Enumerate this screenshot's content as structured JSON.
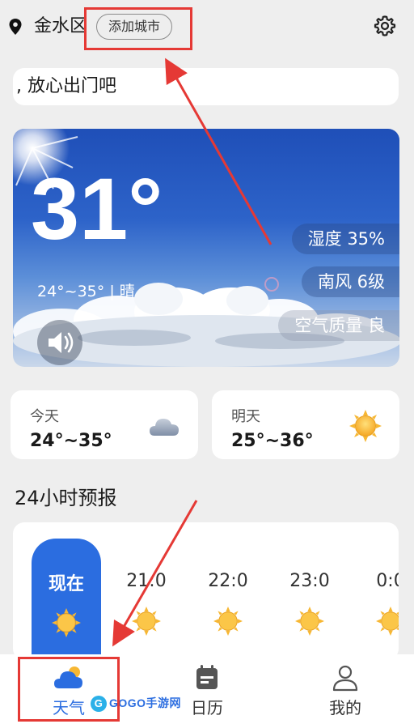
{
  "header": {
    "city": "金水区",
    "add_city_label": "添加城市"
  },
  "tip": ", 放心出门吧",
  "current": {
    "temperature": "31°",
    "range_condition": "24°~35° | 晴",
    "humidity": "湿度 35%",
    "wind": "南风 6级",
    "air_quality": "空气质量 良"
  },
  "forecast_days": [
    {
      "label": "今天",
      "range": "24°~35°",
      "icon": "cloudy-icon"
    },
    {
      "label": "明天",
      "range": "25°~36°",
      "icon": "sunny-icon"
    }
  ],
  "hourly": {
    "title": "24小时预报",
    "items": [
      {
        "time": "现在",
        "icon": "sunny-icon"
      },
      {
        "time": "21:0",
        "icon": "sunny-icon"
      },
      {
        "time": "22:0",
        "icon": "sunny-icon"
      },
      {
        "time": "23:0",
        "icon": "sunny-icon"
      },
      {
        "time": "0:0",
        "icon": "sunny-icon"
      }
    ]
  },
  "tabs": [
    {
      "label": "天气",
      "icon": "weather-cloud-icon",
      "active": true
    },
    {
      "label": "日历",
      "icon": "calendar-icon",
      "active": false
    },
    {
      "label": "我的",
      "icon": "user-icon",
      "active": false
    }
  ],
  "watermark": "GOGO手游网",
  "colors": {
    "accent": "#2b6de0",
    "annotation": "#e53935",
    "background": "#eeeeee"
  }
}
